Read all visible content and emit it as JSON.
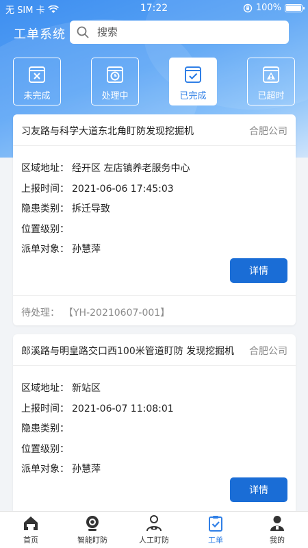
{
  "status_bar": {
    "carrier": "无 SIM 卡",
    "time": "17:22",
    "battery": "100%"
  },
  "app": {
    "title": "工单系统"
  },
  "search": {
    "placeholder": "搜索"
  },
  "tabs": [
    {
      "label": "未完成",
      "icon": "window-close-icon",
      "active": false
    },
    {
      "label": "处理中",
      "icon": "clock-window-icon",
      "active": false
    },
    {
      "label": "已完成",
      "icon": "check-window-icon",
      "active": true
    },
    {
      "label": "已超时",
      "icon": "warning-window-icon",
      "active": false
    }
  ],
  "orders": [
    {
      "title": "习友路与科学大道东北角盯防发现挖掘机",
      "company": "合肥公司",
      "fields": [
        {
          "label": "区域地址：",
          "value": "经开区 左店镇养老服务中心"
        },
        {
          "label": "上报时间：",
          "value": "2021-06-06 17:45:03"
        },
        {
          "label": "隐患类别：",
          "value": "拆迁导致"
        },
        {
          "label": "位置级别：",
          "value": ""
        },
        {
          "label": "派单对象：",
          "value": "孙慧萍"
        }
      ],
      "detail_label": "详情",
      "status_label": "待处理：",
      "code": "【YH-20210607-001】"
    },
    {
      "title": "郎溪路与明皇路交口西100米管道盯防 发现挖掘机",
      "company": "合肥公司",
      "fields": [
        {
          "label": "区域地址：",
          "value": "新站区"
        },
        {
          "label": "上报时间：",
          "value": "2021-06-07 11:08:01"
        },
        {
          "label": "隐患类别：",
          "value": ""
        },
        {
          "label": "位置级别：",
          "value": ""
        },
        {
          "label": "派单对象：",
          "value": "孙慧萍"
        }
      ],
      "detail_label": "详情"
    }
  ],
  "nav": [
    {
      "label": "首页",
      "icon": "home-icon"
    },
    {
      "label": "智能盯防",
      "icon": "camera-icon"
    },
    {
      "label": "人工盯防",
      "icon": "person-eye-icon"
    },
    {
      "label": "工单",
      "icon": "clipboard-check-icon",
      "active": true
    },
    {
      "label": "我的",
      "icon": "user-icon"
    }
  ],
  "colors": {
    "primary": "#1a6dd6",
    "accent": "#2f7fe6",
    "header_start": "#3d8ef0"
  }
}
